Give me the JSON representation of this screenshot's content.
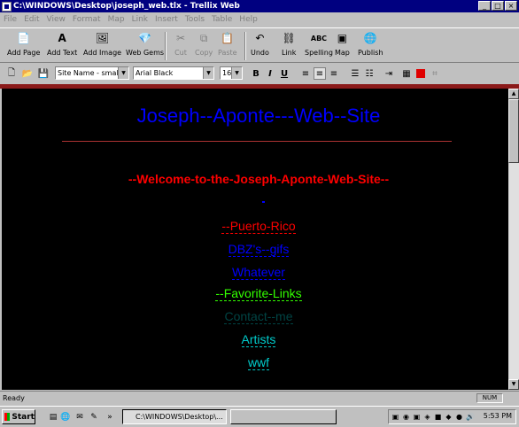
{
  "window": {
    "title": "C:\\WINDOWS\\Desktop\\joseph_web.tlx - Trellix Web",
    "minimize": "_",
    "maximize": "□",
    "close": "×"
  },
  "menu": [
    "File",
    "Edit",
    "View",
    "Format",
    "Map",
    "Link",
    "Insert",
    "Tools",
    "Table",
    "Help"
  ],
  "toolbar": {
    "add_page": "Add Page",
    "add_text": "Add Text",
    "add_image": "Add Image",
    "web_gems": "Web Gems",
    "cut": "Cut",
    "copy": "Copy",
    "paste": "Paste",
    "undo": "Undo",
    "link": "Link",
    "spelling": "Spelling",
    "map": "Map",
    "publish": "Publish"
  },
  "format_bar": {
    "style": "Site Name - small",
    "font": "Arial Black",
    "size": "16",
    "bold": "B",
    "italic": "I",
    "underline": "U"
  },
  "document": {
    "title": "Joseph--Aponte---Web--Site",
    "welcome": "--Welcome-to-the-Joseph-Aponte-Web-Site--",
    "links": [
      {
        "label": "--Puerto-Rico",
        "color": "#ff0000"
      },
      {
        "label": "DBZ's--gifs",
        "color": "#0000ff"
      },
      {
        "label": "Whatever",
        "color": "#0000ff"
      },
      {
        "label": "--Favorite-Links",
        "color": "#33ff00"
      },
      {
        "label": "Contact--me",
        "color": "#004444"
      },
      {
        "label": "Artists",
        "color": "#00cccc"
      },
      {
        "label": "wwf",
        "color": "#00cccc"
      }
    ]
  },
  "status": {
    "text": "Ready",
    "num": "NUM"
  },
  "taskbar": {
    "start": "Start",
    "task_active": "C:\\WINDOWS\\Desktop\\...",
    "time": "5:53 PM"
  }
}
